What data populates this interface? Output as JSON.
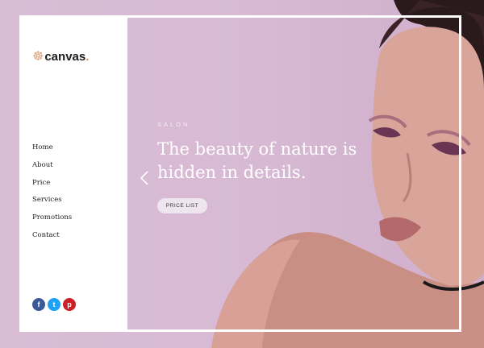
{
  "brand": {
    "name": "canvas",
    "dot": "."
  },
  "nav": {
    "items": [
      {
        "label": "Home"
      },
      {
        "label": "About"
      },
      {
        "label": "Price"
      },
      {
        "label": "Services"
      },
      {
        "label": "Promotions"
      },
      {
        "label": "Contact"
      }
    ]
  },
  "hero": {
    "kicker": "SALON",
    "headline": "The beauty of nature is hidden in details.",
    "cta_label": "PRICE LIST"
  },
  "social": [
    {
      "icon": "facebook-icon",
      "glyph": "f",
      "color": "#3b5998"
    },
    {
      "icon": "twitter-icon",
      "glyph": "t",
      "color": "#1da1f2"
    },
    {
      "icon": "pinterest-icon",
      "glyph": "p",
      "color": "#cb2027"
    }
  ],
  "colors": {
    "background": "#d7b9d3",
    "accent": "#e08a60"
  }
}
